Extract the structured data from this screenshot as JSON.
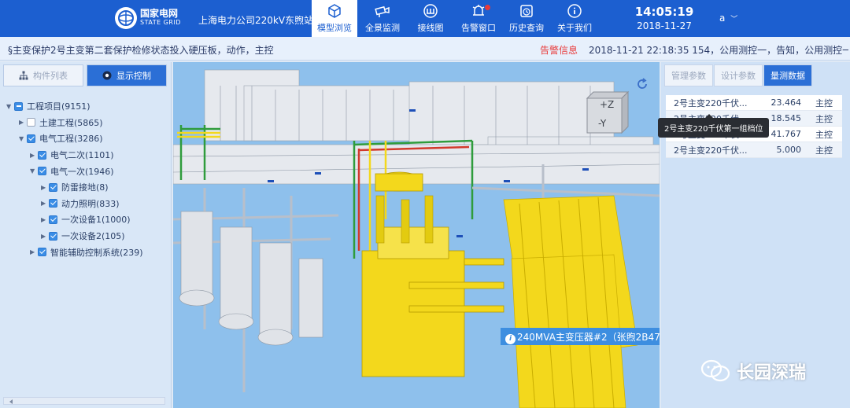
{
  "header": {
    "logo_cn": "国家电网",
    "logo_en": "STATE GRID",
    "station": "上海电力公司220kV东煦站",
    "nav": [
      {
        "label": "模型浏览",
        "icon": "cube-icon",
        "active": true
      },
      {
        "label": "全景监测",
        "icon": "camera-icon"
      },
      {
        "label": "接线图",
        "icon": "wiring-icon"
      },
      {
        "label": "告警窗口",
        "icon": "alarm-icon"
      },
      {
        "label": "历史查询",
        "icon": "history-icon"
      },
      {
        "label": "关于我们",
        "icon": "info-icon"
      }
    ],
    "time": "14:05:19",
    "date": "2018-11-27",
    "user": "a"
  },
  "ticker": {
    "left_text": "§主变保护2号主变第二套保护检修状态投入硬压板，动作，主控",
    "label": "告警信息",
    "right_text": "2018-11-21 22:18:35 154，公用测控一，告知，公用测控一"
  },
  "left_panel": {
    "tabs": [
      {
        "label": "构件列表",
        "icon": "hierarchy-icon"
      },
      {
        "label": "显示控制",
        "icon": "eye-icon"
      }
    ],
    "tree": [
      {
        "label": "工程项目(9151)",
        "level": 0,
        "arrow": "▼",
        "check": "partial"
      },
      {
        "label": "土建工程(5865)",
        "level": 1,
        "arrow": "▶",
        "check": "off"
      },
      {
        "label": "电气工程(3286)",
        "level": 1,
        "arrow": "▼",
        "check": "on"
      },
      {
        "label": "电气二次(1101)",
        "level": 2,
        "arrow": "▶",
        "check": "on"
      },
      {
        "label": "电气一次(1946)",
        "level": 2,
        "arrow": "▼",
        "check": "on"
      },
      {
        "label": "防雷接地(8)",
        "level": 3,
        "arrow": "▶",
        "check": "on"
      },
      {
        "label": "动力照明(833)",
        "level": 3,
        "arrow": "▶",
        "check": "on"
      },
      {
        "label": "一次设备1(1000)",
        "level": 3,
        "arrow": "▶",
        "check": "on"
      },
      {
        "label": "一次设备2(105)",
        "level": 3,
        "arrow": "▶",
        "check": "on"
      },
      {
        "label": "智能辅助控制系统(239)",
        "level": 2,
        "arrow": "▶",
        "check": "on"
      }
    ]
  },
  "viewport": {
    "cube_top": "+Z",
    "cube_front": "-Y",
    "component_label": "240MVA主变压器#2（张煦2B47"
  },
  "right_panel": {
    "tabs": [
      {
        "label": "管理参数"
      },
      {
        "label": "设计参数"
      },
      {
        "label": "量测数据",
        "active": true
      }
    ],
    "rows": [
      {
        "name": "2号主变220千伏...",
        "value": "23.464",
        "source": "主控"
      },
      {
        "name": "2号主变220千伏...",
        "value": "18.545",
        "source": "主控"
      },
      {
        "name": "2号主变220千伏...",
        "value": "41.767",
        "source": "主控"
      },
      {
        "name": "2号主变220千伏...",
        "value": "5.000",
        "source": "主控"
      }
    ],
    "tooltip": "2号主变220千伏第一组档位"
  },
  "watermark": "长园深瑞",
  "colors": {
    "header_bg": "#1c5fd0",
    "accent": "#2b6fd6",
    "alarm": "#e83a3a",
    "equipment": "#f3d81c"
  }
}
